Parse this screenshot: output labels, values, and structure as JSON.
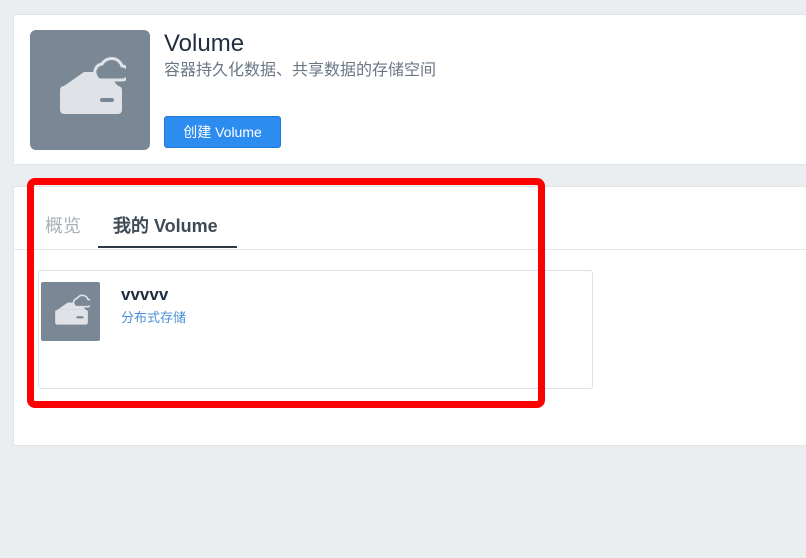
{
  "header": {
    "title": "Volume",
    "subtitle": "容器持久化数据、共享数据的存储空间",
    "create_button_label": "创建 Volume",
    "icon": "volume-cloud-drive-icon"
  },
  "tabs": [
    {
      "label": "概览",
      "active": false
    },
    {
      "label": "我的 Volume",
      "active": true
    }
  ],
  "volumes": [
    {
      "name": "vvvvv",
      "type": "分布式存储",
      "icon": "volume-cloud-drive-icon"
    }
  ],
  "colors": {
    "accent": "#2d8cf0",
    "tile": "#7a8896",
    "highlight": "#ff0000",
    "link": "#4a8fd8"
  }
}
